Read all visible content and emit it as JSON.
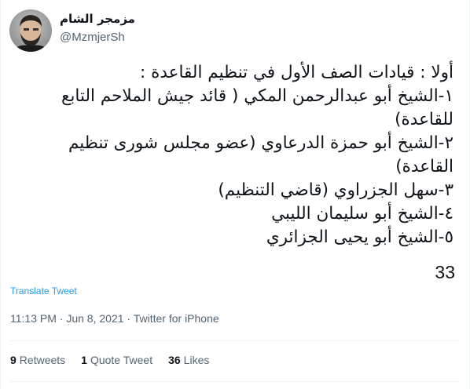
{
  "user": {
    "display_name": "مزمجر الشام",
    "handle": "@MzmjerSh"
  },
  "tweet": {
    "lines": [
      "أولا : قيادات الصف الأول في تنظيم القاعدة :",
      "١-الشيخ أبو عبدالرحمن المكي ( قائد جيش الملاحم التابع",
      "للقاعدة)",
      "٢-الشيخ أبو حمزة الدرعاوي (عضو مجلس شورى تنظيم",
      "القاعدة)",
      "٣-سهل الجزراوي (قاضي التنظيم)",
      "٤-الشيخ أبو سليمان الليبي",
      "٥-الشيخ أبو يحيى الجزائري"
    ],
    "count": "33",
    "translate_label": "Translate Tweet"
  },
  "meta": {
    "time": "11:13 PM",
    "separator": " · ",
    "date": "Jun 8, 2021",
    "source": "Twitter for iPhone"
  },
  "stats": {
    "retweets_count": "9",
    "retweets_label": "Retweets",
    "quotes_count": "1",
    "quotes_label": "Quote Tweet",
    "likes_count": "36",
    "likes_label": "Likes"
  },
  "colors": {
    "link": "#1d9bf0",
    "secondary_text": "#536471",
    "primary_text": "#0f1419"
  }
}
